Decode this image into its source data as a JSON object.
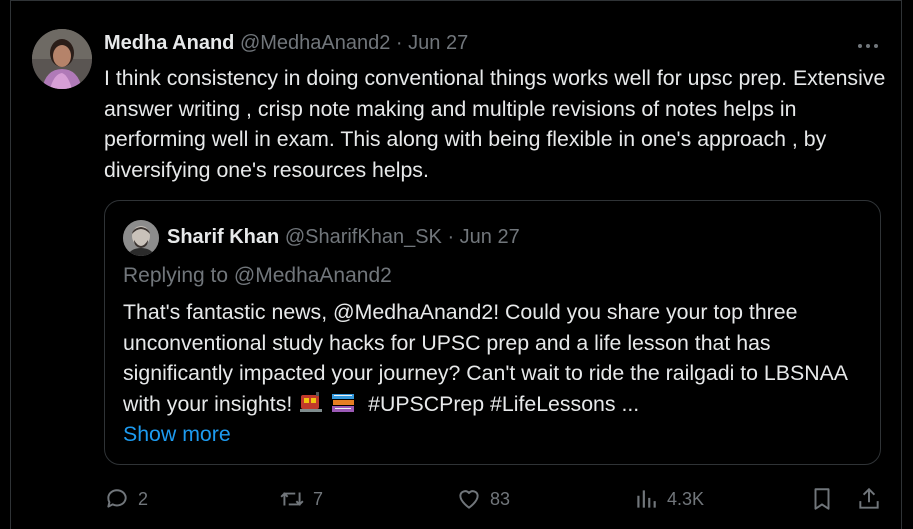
{
  "post": {
    "author_name": "Medha Anand",
    "author_handle": "@MedhaAnand2",
    "separator": "·",
    "date": "Jun 27",
    "text": "I think consistency in doing conventional things works well for upsc prep. Extensive answer writing , crisp note making and multiple revisions of notes helps in performing well in exam. This along with being flexible in one's approach , by diversifying one's resources helps.",
    "more_icon": "more-horizontal-icon"
  },
  "quote": {
    "author_name": "Sharif Khan",
    "author_handle": "@SharifKhan_SK",
    "separator": "·",
    "date": "Jun 27",
    "replying_to": "Replying to @MedhaAnand2",
    "text_part1": "That's fantastic news, @MedhaAnand2! Could you share your top three unconventional study hacks for UPSC prep and a life lesson that has significantly impacted your journey? Can't wait to ride the railgadi to LBSNAA with your insights!",
    "emoji_1": "train-emoji",
    "emoji_2": "books-emoji",
    "text_part2": "#UPSCPrep #LifeLessons ...",
    "show_more": "Show more"
  },
  "actions": {
    "replies": "2",
    "reposts": "7",
    "likes": "83",
    "views": "4.3K",
    "reply_icon": "reply-icon",
    "repost_icon": "repost-icon",
    "like_icon": "heart-icon",
    "views_icon": "views-icon",
    "bookmark_icon": "bookmark-icon",
    "share_icon": "share-icon"
  },
  "colors": {
    "background": "#000000",
    "text": "#e7e9ea",
    "muted": "#71767b",
    "link": "#1d9bf0",
    "border": "#2f3336"
  }
}
